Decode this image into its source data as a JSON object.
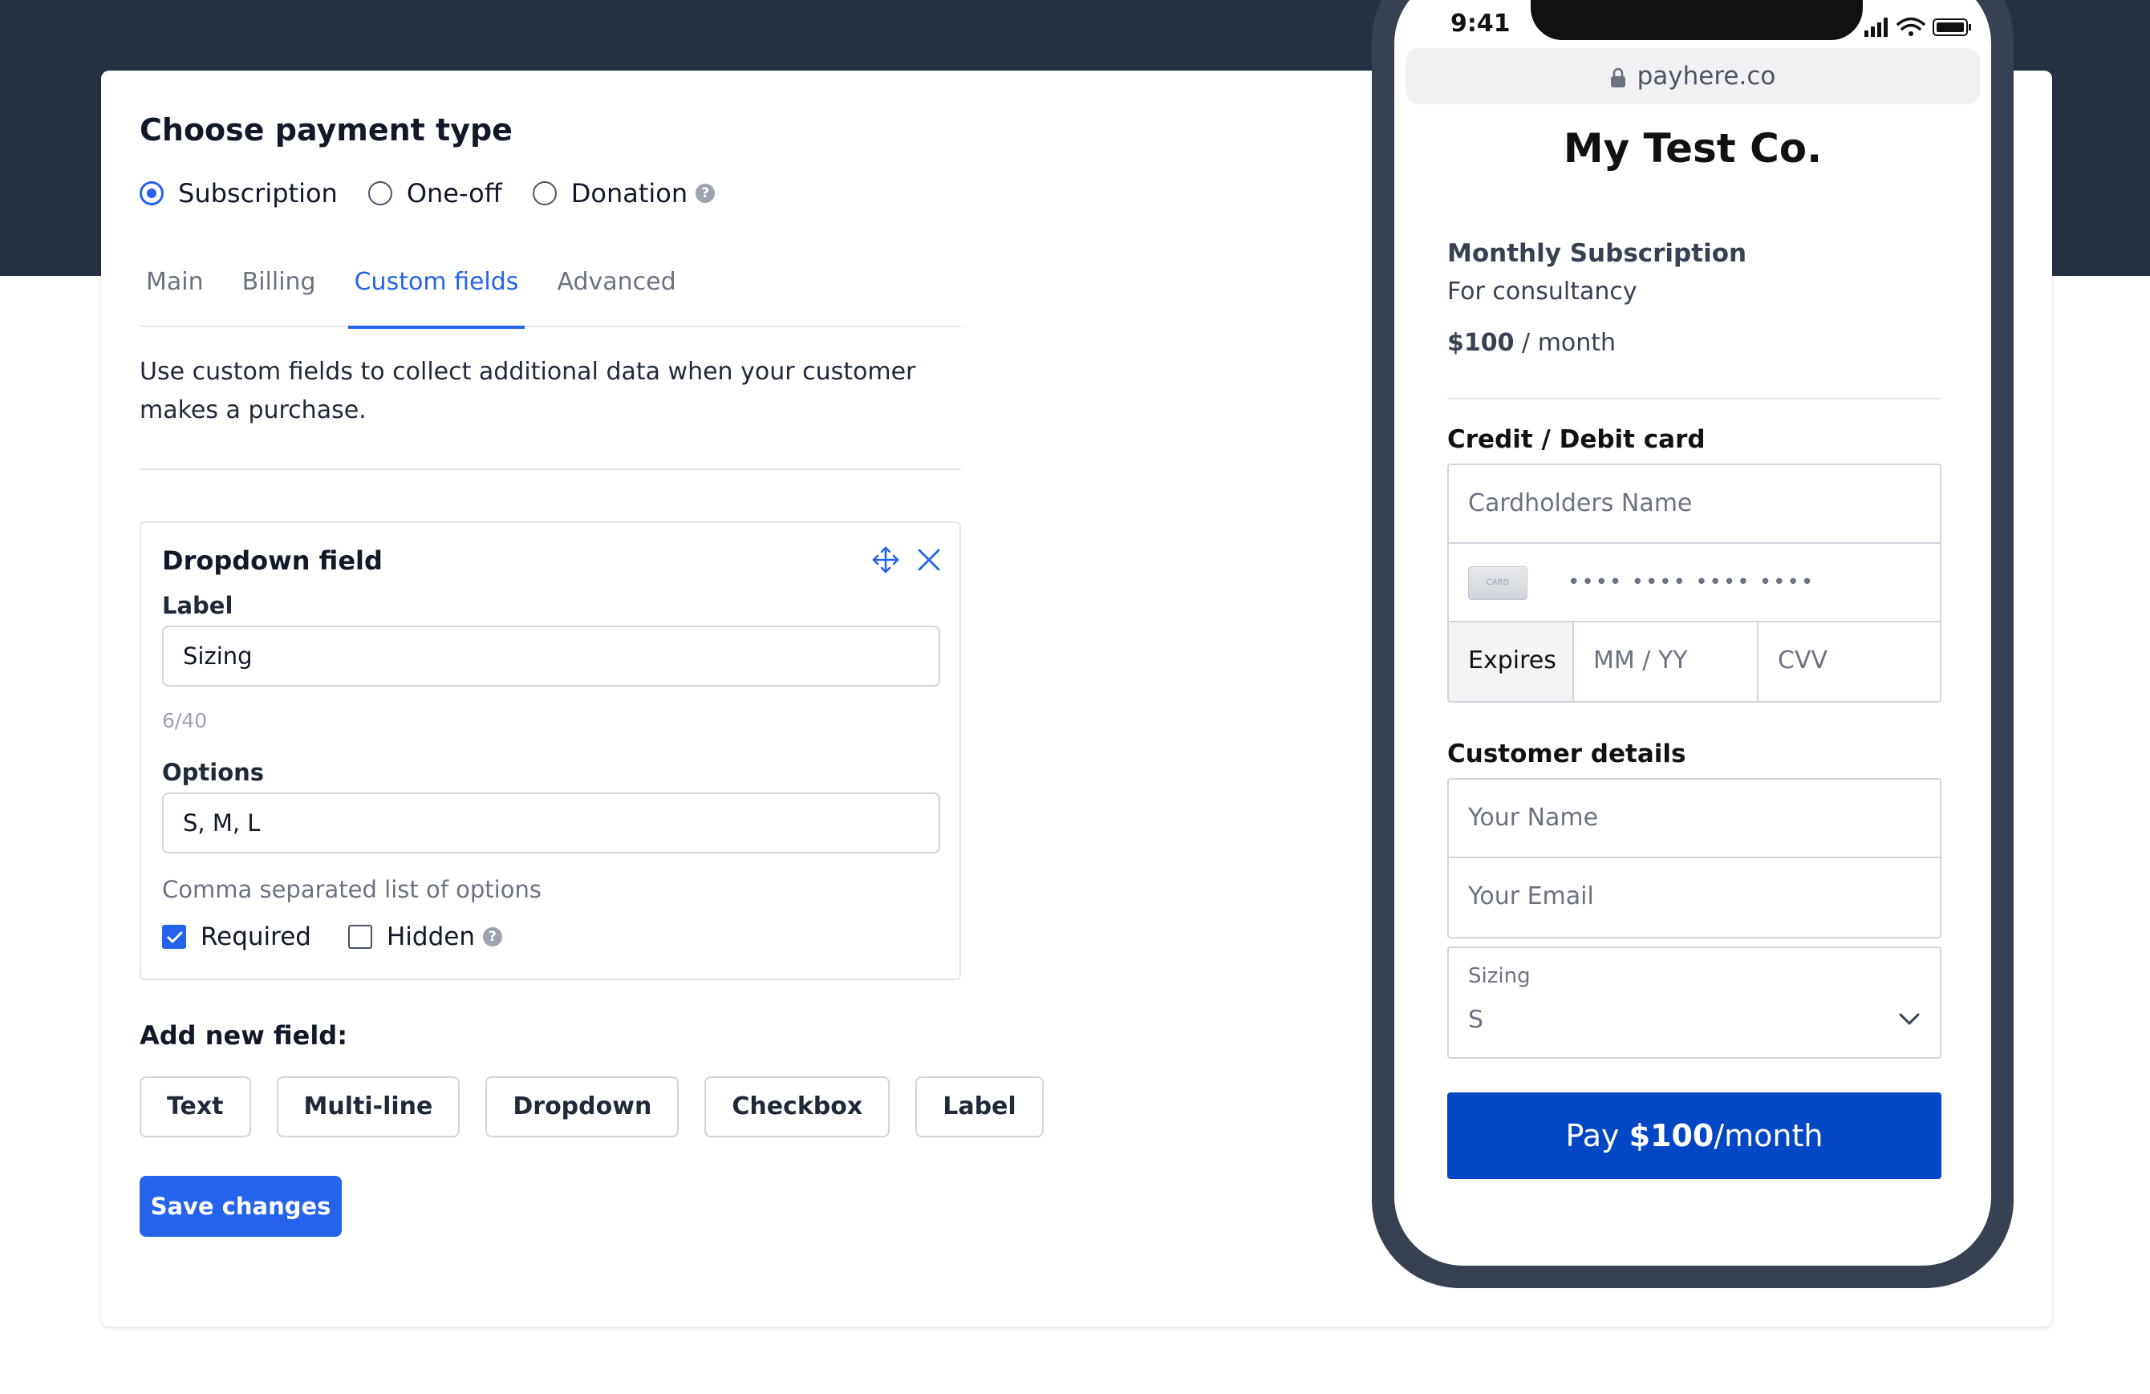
{
  "payment_type": {
    "title": "Choose payment type",
    "options": [
      {
        "label": "Subscription",
        "selected": true
      },
      {
        "label": "One-off",
        "selected": false
      },
      {
        "label": "Donation",
        "selected": false
      }
    ]
  },
  "tabs": [
    {
      "label": "Main",
      "active": false
    },
    {
      "label": "Billing",
      "active": false
    },
    {
      "label": "Custom fields",
      "active": true
    },
    {
      "label": "Advanced",
      "active": false
    }
  ],
  "description": "Use custom fields to collect additional data when your customer makes a purchase.",
  "field": {
    "title": "Dropdown field",
    "label_caption": "Label",
    "label_value": "Sizing",
    "counter": "6/40",
    "options_caption": "Options",
    "options_value": "S, M, L",
    "options_hint": "Comma separated list of options",
    "required_label": "Required",
    "required_checked": true,
    "hidden_label": "Hidden",
    "hidden_checked": false
  },
  "add_new": {
    "title": "Add new field:",
    "buttons": [
      "Text",
      "Multi-line",
      "Dropdown",
      "Checkbox",
      "Label"
    ]
  },
  "save_label": "Save changes",
  "phone": {
    "time": "9:41",
    "url": "payhere.co",
    "company": "My Test Co.",
    "product_name": "Monthly Subscription",
    "product_desc": "For consultancy",
    "price": "$100",
    "price_period": "/ month",
    "card_section": "Credit / Debit card",
    "cardholder_placeholder": "Cardholders Name",
    "card_icon_text": "CARD",
    "card_number_placeholder": "•••• •••• •••• ••••",
    "expires_label": "Expires",
    "mmyy_placeholder": "MM / YY",
    "cvv_placeholder": "CVV",
    "customer_section": "Customer details",
    "name_placeholder": "Your Name",
    "email_placeholder": "Your Email",
    "select_label": "Sizing",
    "select_value": "S",
    "pay_prefix": "Pay",
    "pay_amount": "$100",
    "pay_suffix": "/month"
  },
  "colors": {
    "header_band": "#253141",
    "accent": "#2563eb",
    "pay_button": "#0447c4",
    "phone_frame": "#374151"
  }
}
